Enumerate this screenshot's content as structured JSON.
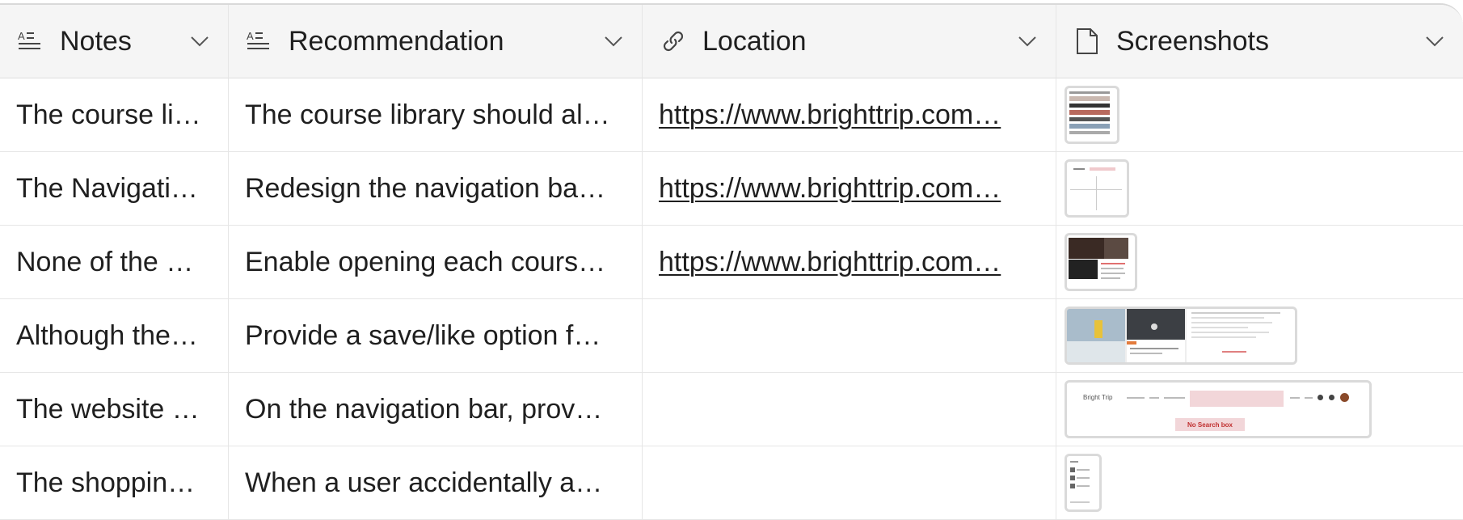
{
  "columns": [
    {
      "label": "Notes",
      "icon": "long-text-icon"
    },
    {
      "label": "Recommendation",
      "icon": "long-text-icon"
    },
    {
      "label": "Location",
      "icon": "link-icon"
    },
    {
      "label": "Screenshots",
      "icon": "file-icon"
    }
  ],
  "rows": [
    {
      "notes": "The course li…",
      "recommendation": "The course library should al…",
      "location": "https://www.brighttrip.com…",
      "screenshots": 1
    },
    {
      "notes": "The Navigati…",
      "recommendation": "Redesign the navigation ba…",
      "location": "https://www.brighttrip.com…",
      "screenshots": 1
    },
    {
      "notes": "None of the …",
      "recommendation": "Enable opening each cours…",
      "location": "https://www.brighttrip.com…",
      "screenshots": 1
    },
    {
      "notes": "Although the…",
      "recommendation": "Provide a save/like option f…",
      "location": "",
      "screenshots": 3
    },
    {
      "notes": "The website …",
      "recommendation": "On the navigation bar, prov…",
      "location": "",
      "screenshots": 1
    },
    {
      "notes": "The shoppin…",
      "recommendation": "When a user accidentally a…",
      "location": "",
      "screenshots": 1
    }
  ],
  "thumbnail_texts": {
    "search_missing_label": "No Search box",
    "brand_label": "Bright Trip"
  },
  "colors": {
    "header_bg": "#f5f5f5",
    "border": "#e6e6e6",
    "thumb_border": "#dadada",
    "accent_pink": "#f2d6d9"
  }
}
